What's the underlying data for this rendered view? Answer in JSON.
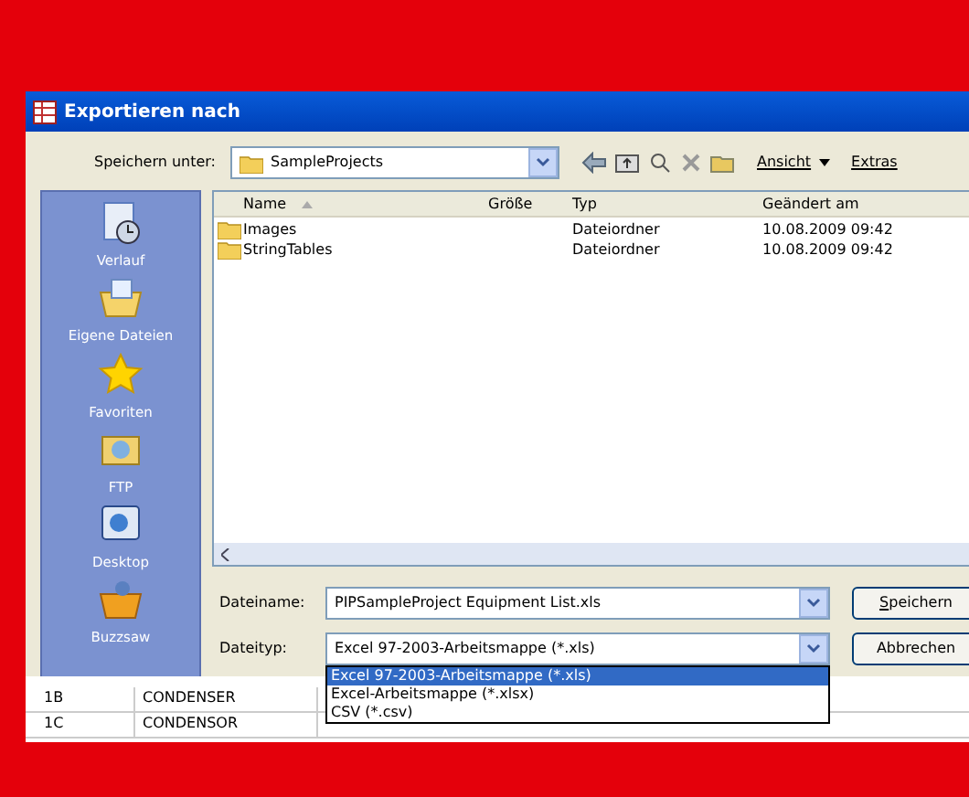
{
  "window": {
    "title": "Exportieren nach"
  },
  "toolbar": {
    "label": "Speichern unter:",
    "folder": "SampleProjects",
    "view_menu": "Ansicht",
    "extras_menu": "Extras"
  },
  "places": [
    {
      "label": "Verlauf",
      "kind": "history"
    },
    {
      "label": "Eigene Dateien",
      "kind": "documents"
    },
    {
      "label": "Favoriten",
      "kind": "favorites"
    },
    {
      "label": "FTP",
      "kind": "ftp"
    },
    {
      "label": "Desktop",
      "kind": "desktop"
    },
    {
      "label": "Buzzsaw",
      "kind": "buzzsaw"
    }
  ],
  "file_list": {
    "columns": [
      "Name",
      "Größe",
      "Typ",
      "Geändert am"
    ],
    "rows": [
      {
        "name": "Images",
        "size": "",
        "type": "Dateiordner",
        "modified": "10.08.2009 09:42"
      },
      {
        "name": "StringTables",
        "size": "",
        "type": "Dateiordner",
        "modified": "10.08.2009 09:42"
      }
    ]
  },
  "filename": {
    "label": "Dateiname:",
    "value": "PIPSampleProject Equipment List.xls"
  },
  "filetype": {
    "label": "Dateityp:",
    "value": "Excel 97-2003-Arbeitsmappe (*.xls)",
    "expanded": true,
    "options": [
      {
        "label": "Excel 97-2003-Arbeitsmappe (*.xls)",
        "selected": true
      },
      {
        "label": "Excel-Arbeitsmappe (*.xlsx)",
        "selected": false
      },
      {
        "label": "CSV (*.csv)",
        "selected": false
      }
    ]
  },
  "buttons": {
    "save": "Speichern",
    "cancel": "Abbrechen"
  },
  "sheet_rows": [
    {
      "column_1": "1B",
      "column_2": "CONDENSER"
    },
    {
      "column_1": "1C",
      "column_2": "CONDENSOR"
    }
  ]
}
